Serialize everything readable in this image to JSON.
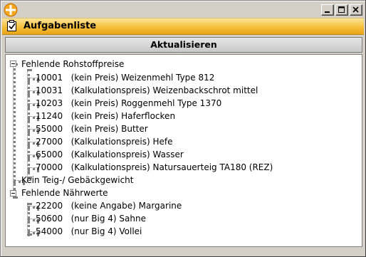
{
  "window": {
    "controls": [
      "minimize",
      "maximize",
      "close"
    ]
  },
  "header": {
    "title": "Aufgabenliste"
  },
  "toolbar": {
    "refresh_label": "Aktualisieren"
  },
  "tree": {
    "groups": [
      {
        "label": "Fehlende Rohstoffpreise",
        "expanded": true,
        "items": [
          "10001   (kein Preis) Weizenmehl Type 812",
          "10031   (Kalkulationspreis) Weizenbackschrot mittel",
          "10203   (kein Preis) Roggenmehl Type 1370",
          "11240   (kein Preis) Haferflocken",
          "55000   (kein Preis) Butter",
          "27000   (Kalkulationspreis) Hefe",
          "65000   (Kalkulationspreis) Wasser",
          "70000   (Kalkulationspreis) Natursauerteig TA180 (REZ)"
        ]
      },
      {
        "label": "Kein Teig-/ Gebäckgewicht",
        "expanded": false,
        "items": []
      },
      {
        "label": "Fehlende Nährwerte",
        "expanded": true,
        "items": [
          "22200   (keine Angabe) Margarine",
          "50600   (nur Big 4) Sahne",
          "54000   (nur Big 4) Vollei"
        ]
      }
    ]
  }
}
